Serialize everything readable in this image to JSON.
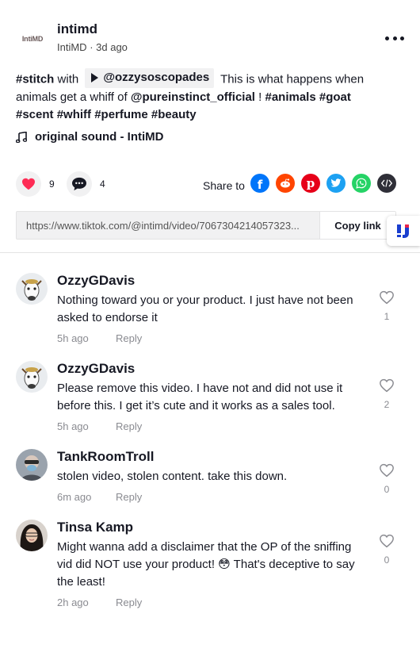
{
  "post": {
    "author_brand": "IntiMD",
    "author_name": "intimd",
    "author_display": "IntiMD",
    "time_ago": "3d ago",
    "desc": {
      "tag_stitch": "#stitch",
      "with": "with",
      "stitch_user": "@ozzysoscopades",
      "text1": "This is what happens when animals get a whiff of",
      "mention": "@pureinstinct_official",
      "bang": "!",
      "tag_animals": "#animals",
      "tag_goat": "#goat",
      "tag_scent": "#scent",
      "tag_whiff": "#whiff",
      "tag_perfume": "#perfume",
      "tag_beauty": "#beauty"
    },
    "sound": "original sound - IntiMD",
    "likes": "9",
    "comments": "4",
    "share_label": "Share to",
    "share_icons": [
      "facebook-icon",
      "reddit-icon",
      "pinterest-icon",
      "twitter-icon",
      "whatsapp-icon",
      "embed-icon"
    ],
    "link_url": "https://www.tiktok.com/@intimd/video/7067304214057323...",
    "copy_label": "Copy link"
  },
  "colors": {
    "like_red": "#fe2c55",
    "facebook": "#0075fa",
    "reddit": "#ff4500",
    "pinterest": "#e60019",
    "twitter": "#1da1f2",
    "whatsapp": "#25d366",
    "embed": "#2f2f38",
    "muted": "#8a8b91"
  },
  "comments": [
    {
      "user": "OzzyGDavis",
      "text": "Nothing toward you or your product. I just have not been asked to endorse it",
      "time": "5h ago",
      "reply": "Reply",
      "likes": "1"
    },
    {
      "user": "OzzyGDavis",
      "text": "Please remove this video. I have not and did not use it before this. I get it’s cute and it works as a sales tool.",
      "time": "5h ago",
      "reply": "Reply",
      "likes": "2"
    },
    {
      "user": "TankRoomTroll",
      "text": "stolen video, stolen content. take this down.",
      "time": "6m ago",
      "reply": "Reply",
      "likes": "0"
    },
    {
      "user": "Tinsa Kamp",
      "text": "Might wanna add a disclaimer that the OP of the sniffing vid did NOT use your product! 😳 That's deceptive to say the least!",
      "time": "2h ago",
      "reply": "Reply",
      "likes": "0"
    }
  ]
}
